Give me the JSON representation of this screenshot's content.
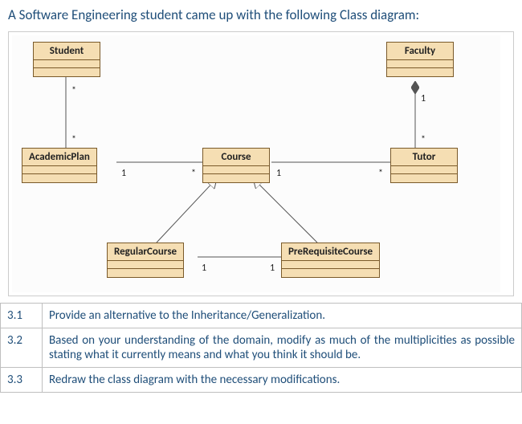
{
  "heading": "A Software Engineering student came up with the following Class diagram:",
  "classes": {
    "student": {
      "name": "Student"
    },
    "faculty": {
      "name": "Faculty"
    },
    "academicPlan": {
      "name": "AcademicPlan"
    },
    "course": {
      "name": "Course"
    },
    "tutor": {
      "name": "Tutor"
    },
    "regularCourse": {
      "name": "RegularCourse"
    },
    "preRequisiteCourse": {
      "name": "PreRequisiteCourse"
    }
  },
  "multiplicities": {
    "student_academicPlan_studentEnd": "*",
    "student_academicPlan_apEnd": "*",
    "faculty_tutor_facultyEnd": "1",
    "faculty_tutor_tutorEnd": "*",
    "academicPlan_course_apEnd": "1",
    "academicPlan_course_courseEnd": "*",
    "course_tutor_courseEnd": "1",
    "course_tutor_tutorEnd": "*",
    "regularCourse_preReq_regEnd": "1",
    "regularCourse_preReq_preEnd": "1"
  },
  "questions": [
    {
      "num": "3.1",
      "text": "Provide an alternative to the Inheritance/Generalization."
    },
    {
      "num": "3.2",
      "text": "Based on your understanding of the domain, modify as much of the multiplicities as possible stating what it currently means and what you think it should be."
    },
    {
      "num": "3.3",
      "text": "Redraw the class diagram with the necessary modifications."
    }
  ]
}
